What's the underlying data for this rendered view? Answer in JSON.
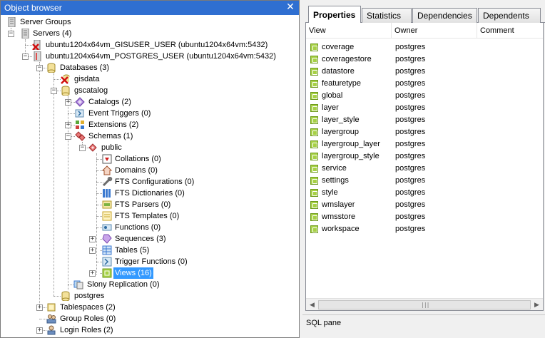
{
  "object_browser": {
    "title": "Object browser",
    "close_glyph": "✕",
    "tree": [
      {
        "label": "Server Groups",
        "icon": "server-group-icon"
      },
      {
        "label": "Servers (4)",
        "icon": "servers-icon",
        "toggle": "−"
      },
      {
        "label": "ubuntu1204x64vm_GISUSER_USER (ubuntu1204x64vm:5432)",
        "icon": "server-disconnected-icon"
      },
      {
        "label": "ubuntu1204x64vm_POSTGRES_USER (ubuntu1204x64vm:5432)",
        "icon": "server-connected-icon",
        "toggle": "−"
      },
      {
        "label": "Databases (3)",
        "icon": "databases-icon",
        "toggle": "−"
      },
      {
        "label": "gisdata",
        "icon": "database-disconnected-icon"
      },
      {
        "label": "gscatalog",
        "icon": "database-icon",
        "toggle": "−"
      },
      {
        "label": "Catalogs (2)",
        "icon": "catalogs-icon",
        "toggle": "+"
      },
      {
        "label": "Event Triggers (0)",
        "icon": "event-triggers-icon"
      },
      {
        "label": "Extensions (2)",
        "icon": "extensions-icon",
        "toggle": "+"
      },
      {
        "label": "Schemas (1)",
        "icon": "schemas-icon",
        "toggle": "−"
      },
      {
        "label": "public",
        "icon": "schema-icon",
        "toggle": "−"
      },
      {
        "label": "Collations (0)",
        "icon": "collations-icon"
      },
      {
        "label": "Domains (0)",
        "icon": "domains-icon"
      },
      {
        "label": "FTS Configurations (0)",
        "icon": "fts-configurations-icon"
      },
      {
        "label": "FTS Dictionaries (0)",
        "icon": "fts-dictionaries-icon"
      },
      {
        "label": "FTS Parsers (0)",
        "icon": "fts-parsers-icon"
      },
      {
        "label": "FTS Templates (0)",
        "icon": "fts-templates-icon"
      },
      {
        "label": "Functions (0)",
        "icon": "functions-icon"
      },
      {
        "label": "Sequences (3)",
        "icon": "sequences-icon",
        "toggle": "+"
      },
      {
        "label": "Tables (5)",
        "icon": "tables-icon",
        "toggle": "+"
      },
      {
        "label": "Trigger Functions (0)",
        "icon": "trigger-functions-icon"
      },
      {
        "label": "Views (16)",
        "icon": "views-icon",
        "toggle": "+",
        "selected": true
      },
      {
        "label": "Slony Replication (0)",
        "icon": "slony-replication-icon"
      },
      {
        "label": "postgres",
        "icon": "database-icon"
      },
      {
        "label": "Tablespaces (2)",
        "icon": "tablespaces-icon",
        "toggle": "+"
      },
      {
        "label": "Group Roles (0)",
        "icon": "group-roles-icon"
      },
      {
        "label": "Login Roles (2)",
        "icon": "login-roles-icon",
        "toggle": "+"
      }
    ]
  },
  "properties_panel": {
    "tabs": [
      "Properties",
      "Statistics",
      "Dependencies",
      "Dependents"
    ],
    "active_tab": "Properties",
    "columns": [
      "View",
      "Owner",
      "Comment"
    ],
    "rows": [
      {
        "view": "coverage",
        "owner": "postgres"
      },
      {
        "view": "coveragestore",
        "owner": "postgres"
      },
      {
        "view": "datastore",
        "owner": "postgres"
      },
      {
        "view": "featuretype",
        "owner": "postgres"
      },
      {
        "view": "global",
        "owner": "postgres"
      },
      {
        "view": "layer",
        "owner": "postgres"
      },
      {
        "view": "layer_style",
        "owner": "postgres"
      },
      {
        "view": "layergroup",
        "owner": "postgres"
      },
      {
        "view": "layergroup_layer",
        "owner": "postgres"
      },
      {
        "view": "layergroup_style",
        "owner": "postgres"
      },
      {
        "view": "service",
        "owner": "postgres"
      },
      {
        "view": "settings",
        "owner": "postgres"
      },
      {
        "view": "style",
        "owner": "postgres"
      },
      {
        "view": "wmslayer",
        "owner": "postgres"
      },
      {
        "view": "wmsstore",
        "owner": "postgres"
      },
      {
        "view": "workspace",
        "owner": "postgres"
      }
    ],
    "scroll_left_glyph": "◀",
    "scroll_right_glyph": "▶",
    "scroll_grip": "|||"
  },
  "sql_pane": {
    "title": "SQL pane"
  },
  "colors": {
    "selection": "#3399ff",
    "title_bar": "#2f6fd1",
    "view_icon": "#a6d045"
  }
}
